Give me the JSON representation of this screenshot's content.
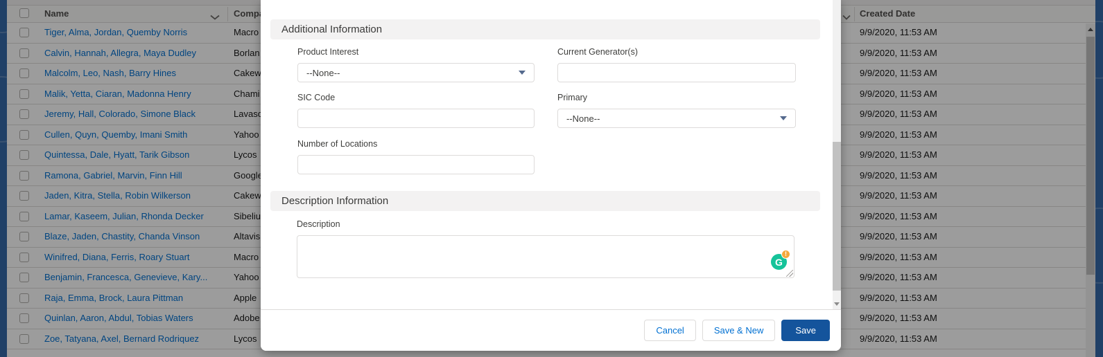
{
  "app": {
    "backdrop_color": "rgba(0,0,0,0.39)",
    "background_color": "#3569a8",
    "link_color": "#0070d2",
    "brand_button_color": "#14549c",
    "grammarly_green": "#15c39a",
    "grammarly_badge_color": "#f3a83c"
  },
  "table": {
    "columns": [
      {
        "label": "Name"
      },
      {
        "label": "Company"
      },
      {
        "label": "Created Date"
      }
    ],
    "rows": [
      {
        "name": "Tiger, Alma, Jordan, Quemby Norris",
        "company": "Macro",
        "created": "9/9/2020, 11:53 AM"
      },
      {
        "name": "Calvin, Hannah, Allegra, Maya Dudley",
        "company": "Borlan",
        "created": "9/9/2020, 11:53 AM"
      },
      {
        "name": "Malcolm, Leo, Nash, Barry Hines",
        "company": "Cakew",
        "created": "9/9/2020, 11:53 AM"
      },
      {
        "name": "Malik, Yetta, Ciaran, Madonna Henry",
        "company": "Chami",
        "created": "9/9/2020, 11:53 AM"
      },
      {
        "name": "Jeremy, Hall, Colorado, Simone Black",
        "company": "Lavaso",
        "created": "9/9/2020, 11:53 AM"
      },
      {
        "name": "Cullen, Quyn, Quemby, Imani Smith",
        "company": "Yahoo",
        "created": "9/9/2020, 11:53 AM"
      },
      {
        "name": "Quintessa, Dale, Hyatt, Tarik Gibson",
        "company": "Lycos",
        "created": "9/9/2020, 11:53 AM"
      },
      {
        "name": "Ramona, Gabriel, Marvin, Finn Hill",
        "company": "Google",
        "created": "9/9/2020, 11:53 AM"
      },
      {
        "name": "Jaden, Kitra, Stella, Robin Wilkerson",
        "company": "Cakew",
        "created": "9/9/2020, 11:53 AM"
      },
      {
        "name": "Lamar, Kaseem, Julian, Rhonda Decker",
        "company": "Sibeliu",
        "created": "9/9/2020, 11:53 AM"
      },
      {
        "name": "Blaze, Jaden, Chastity, Chanda Vinson",
        "company": "Altavis",
        "created": "9/9/2020, 11:53 AM"
      },
      {
        "name": "Winifred, Diana, Ferris, Roary Stuart",
        "company": "Macro",
        "created": "9/9/2020, 11:53 AM"
      },
      {
        "name": "Benjamin, Francesca, Genevieve, Kary...",
        "company": "Yahoo",
        "created": "9/9/2020, 11:53 AM"
      },
      {
        "name": "Raja, Emma, Brock, Laura Pittman",
        "company": "Apple",
        "created": "9/9/2020, 11:53 AM"
      },
      {
        "name": "Quinlan, Aaron, Abdul, Tobias Waters",
        "company": "Adobe",
        "created": "9/9/2020, 11:53 AM"
      },
      {
        "name": "Zoe, Tatyana, Axel, Bernard Rodriquez",
        "company": "Lycos",
        "created": "9/9/2020, 11:53 AM"
      }
    ]
  },
  "modal": {
    "sections": [
      {
        "title": "Additional Information"
      },
      {
        "title": "Description Information"
      }
    ],
    "fields": {
      "product_interest": {
        "label": "Product Interest",
        "value": "--None--"
      },
      "current_generators": {
        "label": "Current Generator(s)",
        "value": ""
      },
      "sic_code": {
        "label": "SIC Code",
        "value": ""
      },
      "primary": {
        "label": "Primary",
        "value": "--None--"
      },
      "number_of_locations": {
        "label": "Number of Locations",
        "value": ""
      },
      "description": {
        "label": "Description",
        "value": ""
      }
    },
    "buttons": {
      "cancel": "Cancel",
      "save_new": "Save & New",
      "save": "Save"
    }
  },
  "icons": {
    "grammarly_letter": "G",
    "grammarly_badge": "!"
  }
}
